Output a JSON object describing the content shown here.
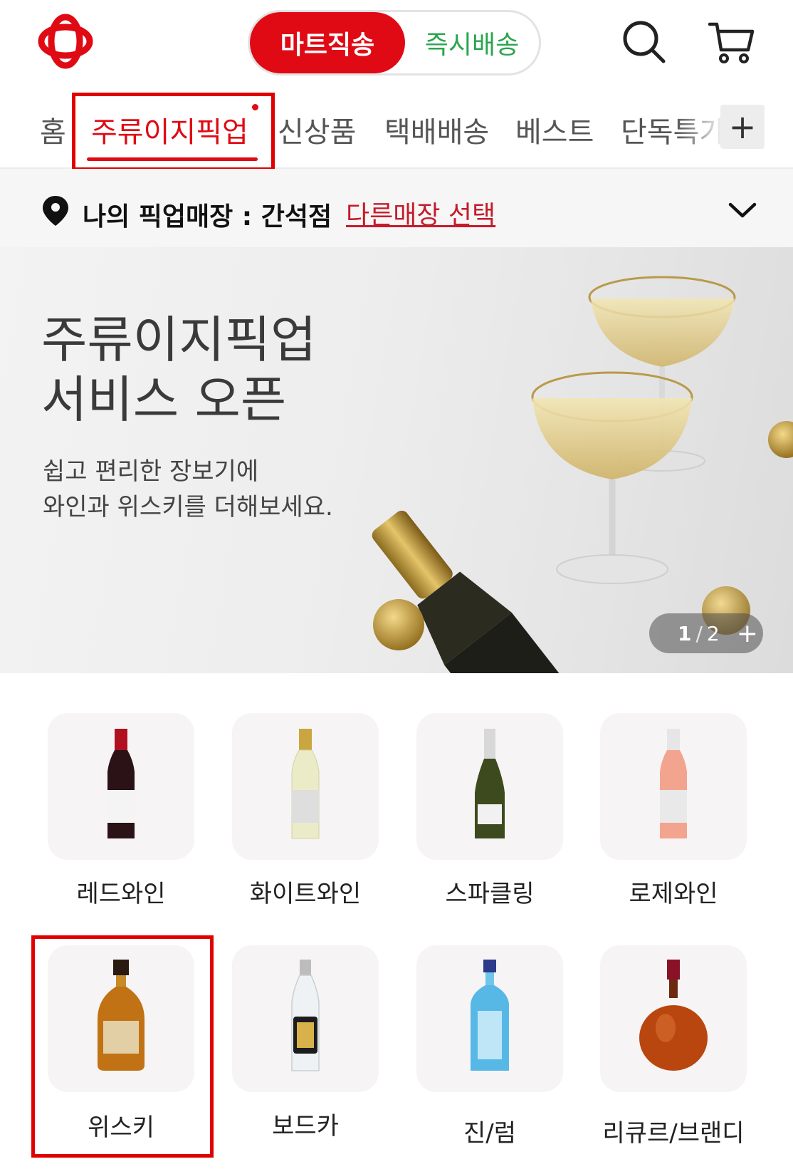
{
  "header": {
    "logo": "logo-icon",
    "toggle_active": "마트직송",
    "toggle_inactive": "즉시배송",
    "search_icon": "search-icon",
    "cart_icon": "cart-icon",
    "brand_color": "#e00a14",
    "inactive_color": "#2aa54d"
  },
  "tabs": {
    "items": [
      "홈",
      "주류이지픽업",
      "신상품",
      "택배배송",
      "베스트",
      "단독특가"
    ],
    "active_index": 1,
    "more_button": "+"
  },
  "store": {
    "label": "나의 픽업매장 : 간석점",
    "change_link": "다른매장 선택"
  },
  "banner": {
    "title_line1": "주류이지픽업",
    "title_line2": "서비스 오픈",
    "subtitle_line1": "쉽고 편리한 장보기에",
    "subtitle_line2": "와인과 위스키를 더해보세요.",
    "page_current": "1",
    "page_total": "2",
    "more_button": "+"
  },
  "categories": [
    {
      "label": "레드와인",
      "icon": "red-wine-bottle-icon"
    },
    {
      "label": "화이트와인",
      "icon": "white-wine-bottle-icon"
    },
    {
      "label": "스파클링",
      "icon": "sparkling-wine-bottle-icon"
    },
    {
      "label": "로제와인",
      "icon": "rose-wine-bottle-icon"
    },
    {
      "label": "위스키",
      "icon": "whisky-bottle-icon"
    },
    {
      "label": "보드카",
      "icon": "vodka-bottle-icon"
    },
    {
      "label": "진/럼",
      "icon": "gin-bottle-icon"
    },
    {
      "label": "리큐르/브랜디",
      "icon": "brandy-bottle-icon"
    }
  ]
}
